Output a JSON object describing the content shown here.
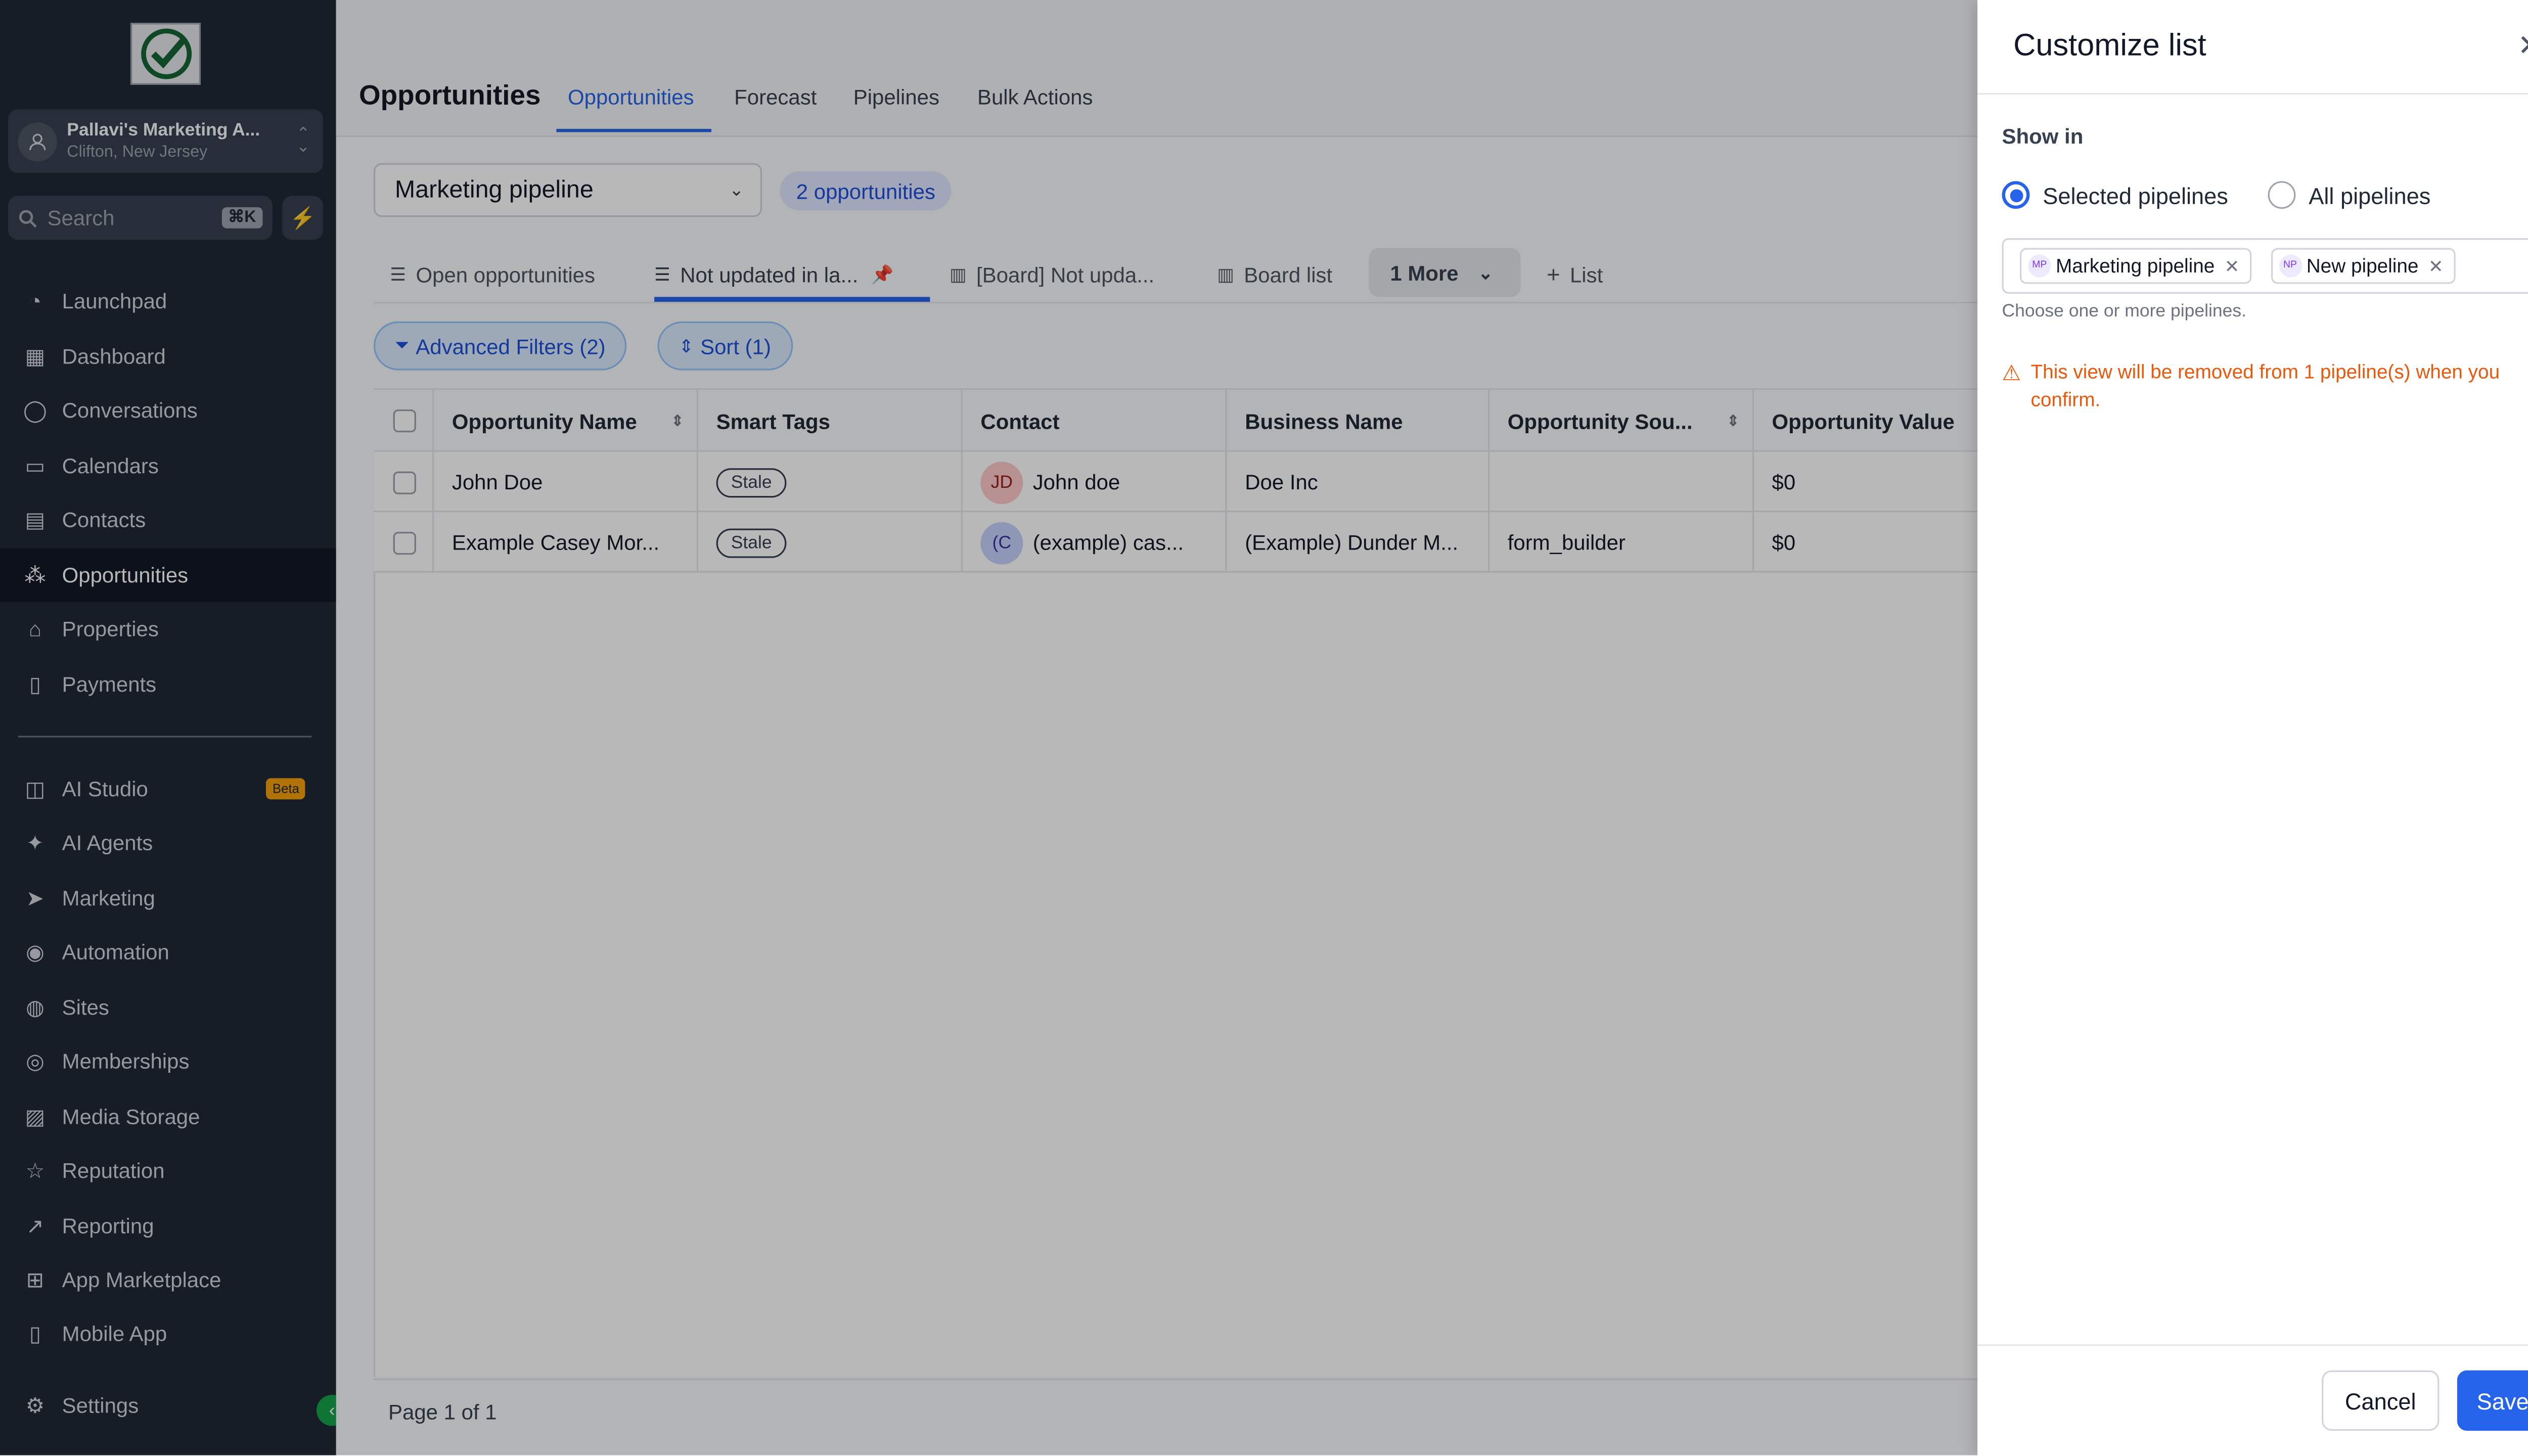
{
  "sidebar": {
    "account_name": "Pallavi's Marketing A...",
    "account_location": "Clifton, New Jersey",
    "search_placeholder": "Search",
    "search_shortcut": "⌘K",
    "items": [
      {
        "label": "Launchpad",
        "icon": "rocket-icon"
      },
      {
        "label": "Dashboard",
        "icon": "grid-icon"
      },
      {
        "label": "Conversations",
        "icon": "chat-icon"
      },
      {
        "label": "Calendars",
        "icon": "calendar-icon"
      },
      {
        "label": "Contacts",
        "icon": "contacts-icon"
      },
      {
        "label": "Opportunities",
        "icon": "network-icon"
      },
      {
        "label": "Properties",
        "icon": "home-icon"
      },
      {
        "label": "Payments",
        "icon": "receipt-icon"
      },
      {
        "label": "AI Studio",
        "icon": "ai-studio-icon",
        "badge": "Beta"
      },
      {
        "label": "AI Agents",
        "icon": "sparkle-icon"
      },
      {
        "label": "Marketing",
        "icon": "send-icon"
      },
      {
        "label": "Automation",
        "icon": "play-circle-icon"
      },
      {
        "label": "Sites",
        "icon": "globe-icon"
      },
      {
        "label": "Memberships",
        "icon": "award-icon"
      },
      {
        "label": "Media Storage",
        "icon": "image-icon"
      },
      {
        "label": "Reputation",
        "icon": "star-icon"
      },
      {
        "label": "Reporting",
        "icon": "trend-icon"
      },
      {
        "label": "App Marketplace",
        "icon": "apps-icon"
      },
      {
        "label": "Mobile App",
        "icon": "phone-icon"
      },
      {
        "label": "Settings",
        "icon": "gear-icon"
      }
    ]
  },
  "header": {
    "title": "Opportunities",
    "tabs": [
      "Opportunities",
      "Forecast",
      "Pipelines",
      "Bulk Actions"
    ]
  },
  "toolbar": {
    "pipeline": "Marketing pipeline",
    "count": "2 opportunities",
    "views": [
      "Open opportunities",
      "Not updated in la...",
      "[Board] Not upda...",
      "Board list"
    ],
    "more": "1 More",
    "add_list": "List",
    "filters": "Advanced Filters (2)",
    "sort": "Sort (1)"
  },
  "table": {
    "columns": [
      "Opportunity Name",
      "Smart Tags",
      "Contact",
      "Business Name",
      "Opportunity Sou...",
      "Opportunity Value"
    ],
    "rows": [
      {
        "name": "John Doe",
        "tag": "Stale",
        "contact_initials": "JD",
        "contact": "John doe",
        "business": "Doe Inc",
        "source": "",
        "value": "$0"
      },
      {
        "name": "Example Casey Mor...",
        "tag": "Stale",
        "contact_initials": "(C",
        "contact": "(example) cas...",
        "business": "(Example) Dunder M...",
        "source": "form_builder",
        "value": "$0"
      }
    ],
    "pagination": "Page 1 of 1"
  },
  "drawer": {
    "title": "Customize list",
    "show_in_label": "Show in",
    "option_selected": "Selected pipelines",
    "option_all": "All pipelines",
    "selected_option": "Selected pipelines",
    "chips": [
      {
        "initials": "MP",
        "label": "Marketing pipeline"
      },
      {
        "initials": "NP",
        "label": "New pipeline"
      }
    ],
    "hint": "Choose one or more pipelines.",
    "warning": "This view will be removed from 1 pipeline(s) when you confirm.",
    "cancel": "Cancel",
    "save": "Save"
  },
  "colors": {
    "sidebar_bg": "#1f2937",
    "accent": "#2563eb",
    "warning": "#ea580c"
  }
}
